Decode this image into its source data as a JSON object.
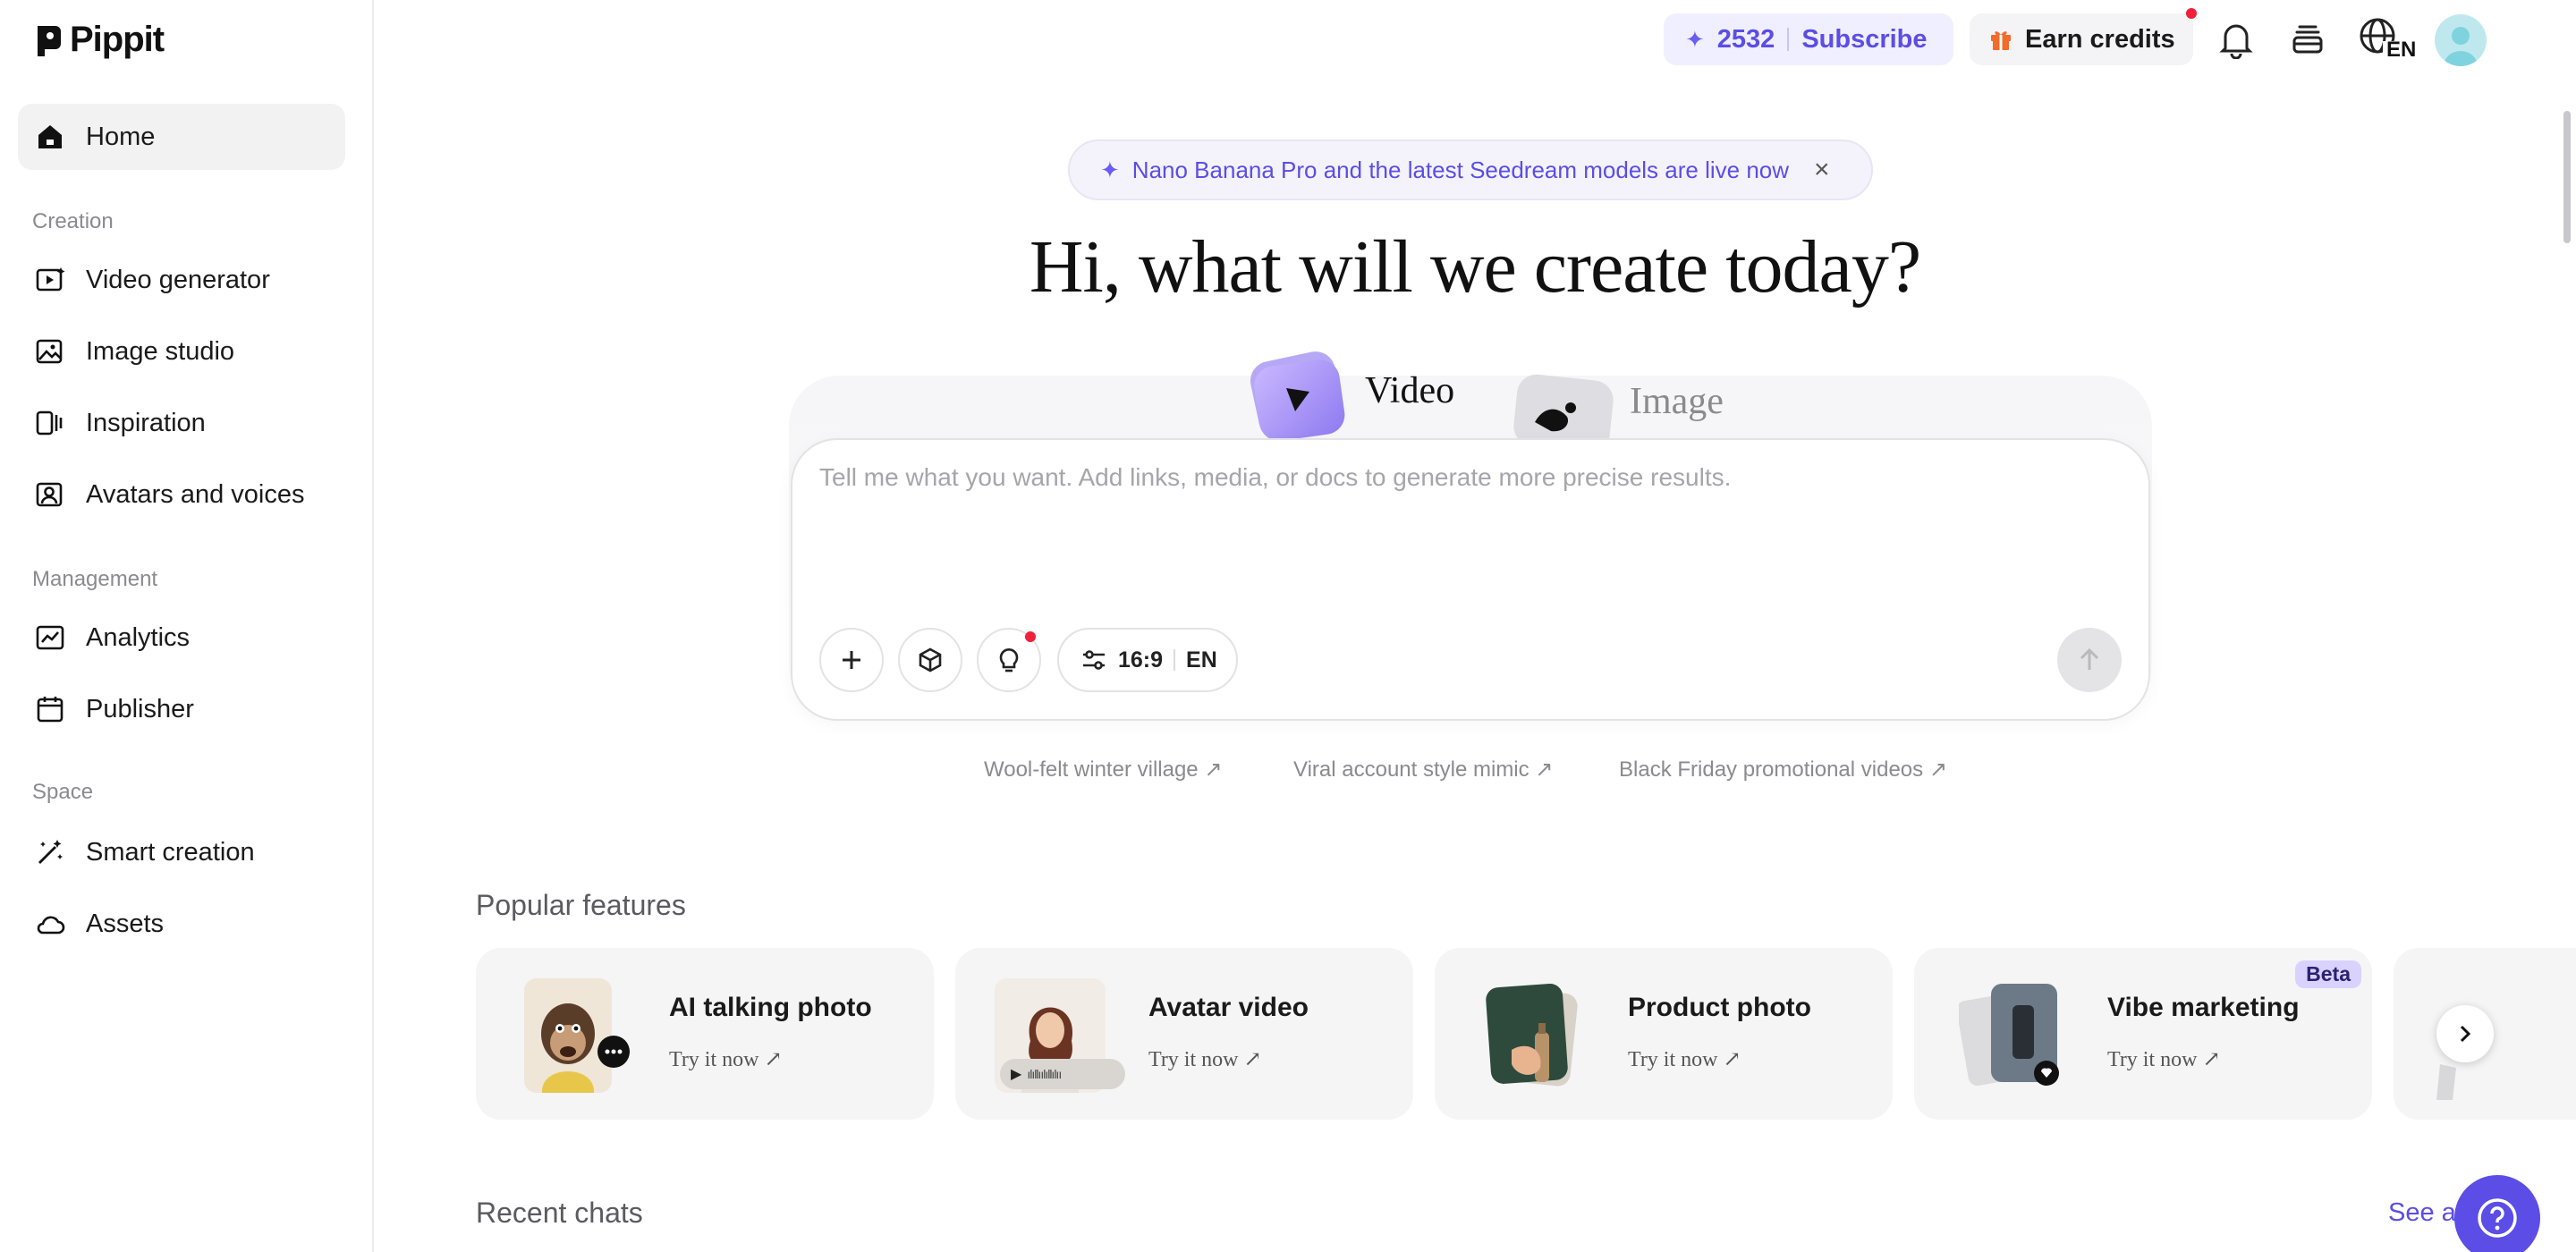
{
  "brand": {
    "name": "Pippit"
  },
  "sidebar": {
    "home": "Home",
    "sections": [
      {
        "label": "Creation",
        "items": [
          "Video generator",
          "Image studio",
          "Inspiration",
          "Avatars and voices"
        ]
      },
      {
        "label": "Management",
        "items": [
          "Analytics",
          "Publisher"
        ]
      },
      {
        "label": "Space",
        "items": [
          "Smart creation",
          "Assets"
        ]
      }
    ]
  },
  "topbar": {
    "credits": "2532",
    "subscribe": "Subscribe",
    "earn_credits": "Earn credits",
    "language": "EN"
  },
  "announcement": {
    "text": "Nano Banana Pro and the latest Seedream models are live now"
  },
  "hero": {
    "title": "Hi, what will we create today?"
  },
  "modes": {
    "video": "Video",
    "image": "Image"
  },
  "prompt": {
    "placeholder": "Tell me what you want. Add links, media, or docs to generate more precise results.",
    "aspect_ratio": "16:9",
    "language": "EN"
  },
  "suggestions": [
    "Wool-felt winter village ↗",
    "Viral account style mimic ↗",
    "Black Friday promotional videos ↗"
  ],
  "popular": {
    "title": "Popular features",
    "cards": [
      {
        "title": "AI talking photo",
        "cta": "Try it now ↗"
      },
      {
        "title": "Avatar video",
        "cta": "Try it now ↗"
      },
      {
        "title": "Product photo",
        "cta": "Try it now ↗"
      },
      {
        "title": "Vibe marketing",
        "cta": "Try it now ↗",
        "badge": "Beta"
      }
    ]
  },
  "recent": {
    "title": "Recent chats",
    "see_all": "See a"
  },
  "colors": {
    "accent": "#5b4de6",
    "accent_light": "#f0efff",
    "notification": "#f0203a"
  },
  "icons": [
    "home-icon",
    "video-generator-icon",
    "image-studio-icon",
    "inspiration-icon",
    "avatar-icon",
    "analytics-icon",
    "calendar-icon",
    "magic-wand-icon",
    "cloud-icon",
    "bell-icon",
    "layers-icon",
    "globe-icon",
    "gift-icon",
    "plus-icon",
    "cube-icon",
    "lightbulb-icon",
    "sliders-icon",
    "arrow-up-icon",
    "chevron-right-icon",
    "help-icon"
  ]
}
